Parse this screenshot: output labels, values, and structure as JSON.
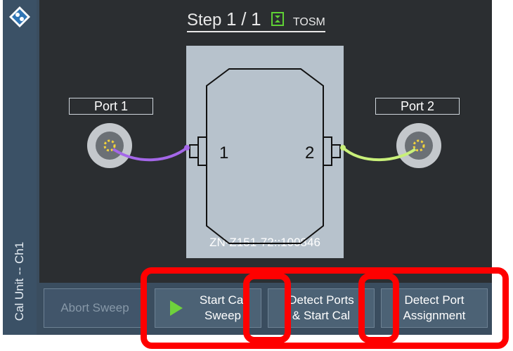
{
  "sidebar": {
    "label": "Cal Unit -- Ch1"
  },
  "step": {
    "text": "Step",
    "current": "1",
    "separator": "/",
    "total": "1",
    "method": "TOSM",
    "icon": "calibration-icon"
  },
  "ports": {
    "port1": "Port 1",
    "port2": "Port 2"
  },
  "cal_unit": {
    "serial": "ZN-Z151-72::100846",
    "connector1": "1",
    "connector2": "2"
  },
  "buttons": {
    "abort": "Abort Sweep",
    "start_line1": "Start Cal",
    "start_line2": "Sweep",
    "detect_line1": "Detect Ports",
    "detect_line2": "& Start Cal",
    "assign_line1": "Detect Port",
    "assign_line2": "Assignment"
  },
  "colors": {
    "highlight": "#ff0000",
    "cable_port1": "#a467e8",
    "cable_port2": "#c9f07a",
    "play": "#6fd13c"
  }
}
